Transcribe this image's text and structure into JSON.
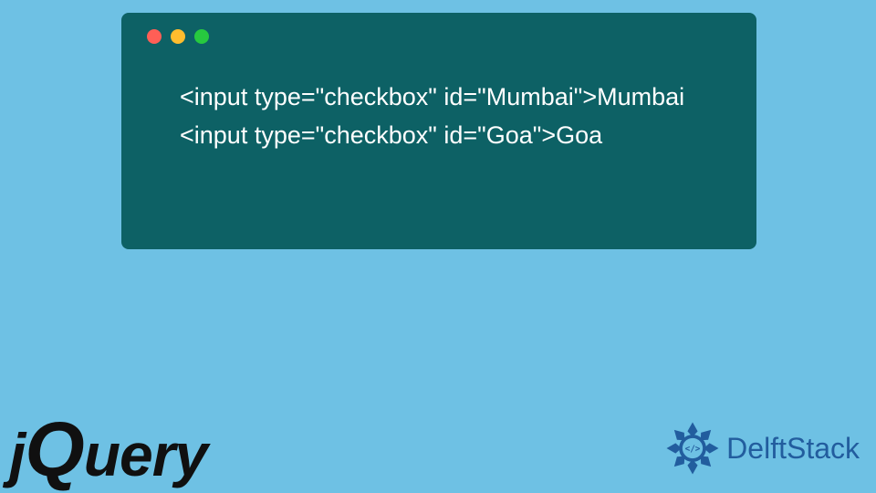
{
  "code": {
    "lines": [
      "<input type=\"checkbox\" id=\"Mumbai\">Mumbai",
      "<input type=\"checkbox\" id=\"Goa\">Goa"
    ]
  },
  "logos": {
    "jquery_j": "j",
    "jquery_q": "Q",
    "jquery_rest": "uery",
    "delftstack": "DelftStack"
  },
  "colors": {
    "background": "#6ec1e4",
    "window": "#0d6165",
    "dot_red": "#ff5f56",
    "dot_yellow": "#ffbd2e",
    "dot_green": "#27c93f",
    "delft_blue": "#225d9e"
  }
}
